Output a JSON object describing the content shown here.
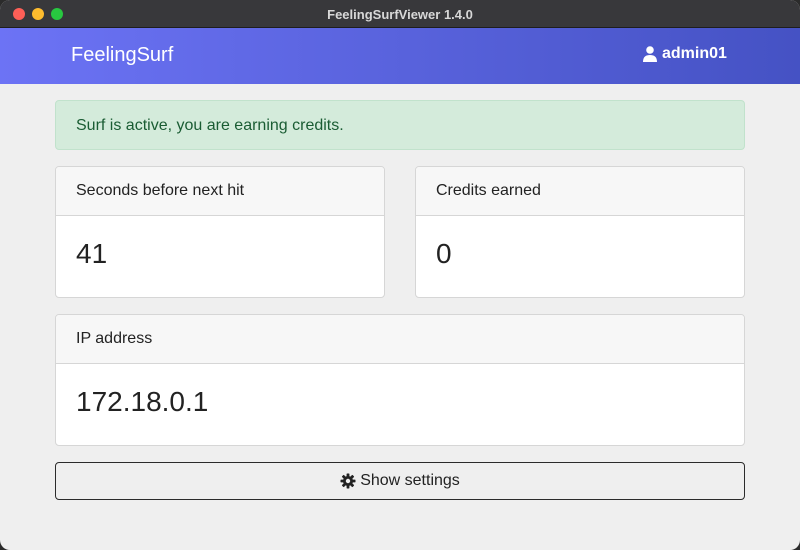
{
  "window": {
    "title": "FeelingSurfViewer 1.4.0"
  },
  "navbar": {
    "brand": "FeelingSurf",
    "username": "admin01",
    "color_start": "#6c73f5",
    "color_end": "#4552c4"
  },
  "alert": {
    "message": "Surf is active, you are earning credits.",
    "type": "success"
  },
  "cards": {
    "seconds": {
      "label": "Seconds before next hit",
      "value": "41"
    },
    "credits": {
      "label": "Credits earned",
      "value": "0"
    },
    "ip": {
      "label": "IP address",
      "value": "172.18.0.1"
    }
  },
  "settings_button": {
    "label": "Show settings",
    "icon": "gear-icon"
  }
}
